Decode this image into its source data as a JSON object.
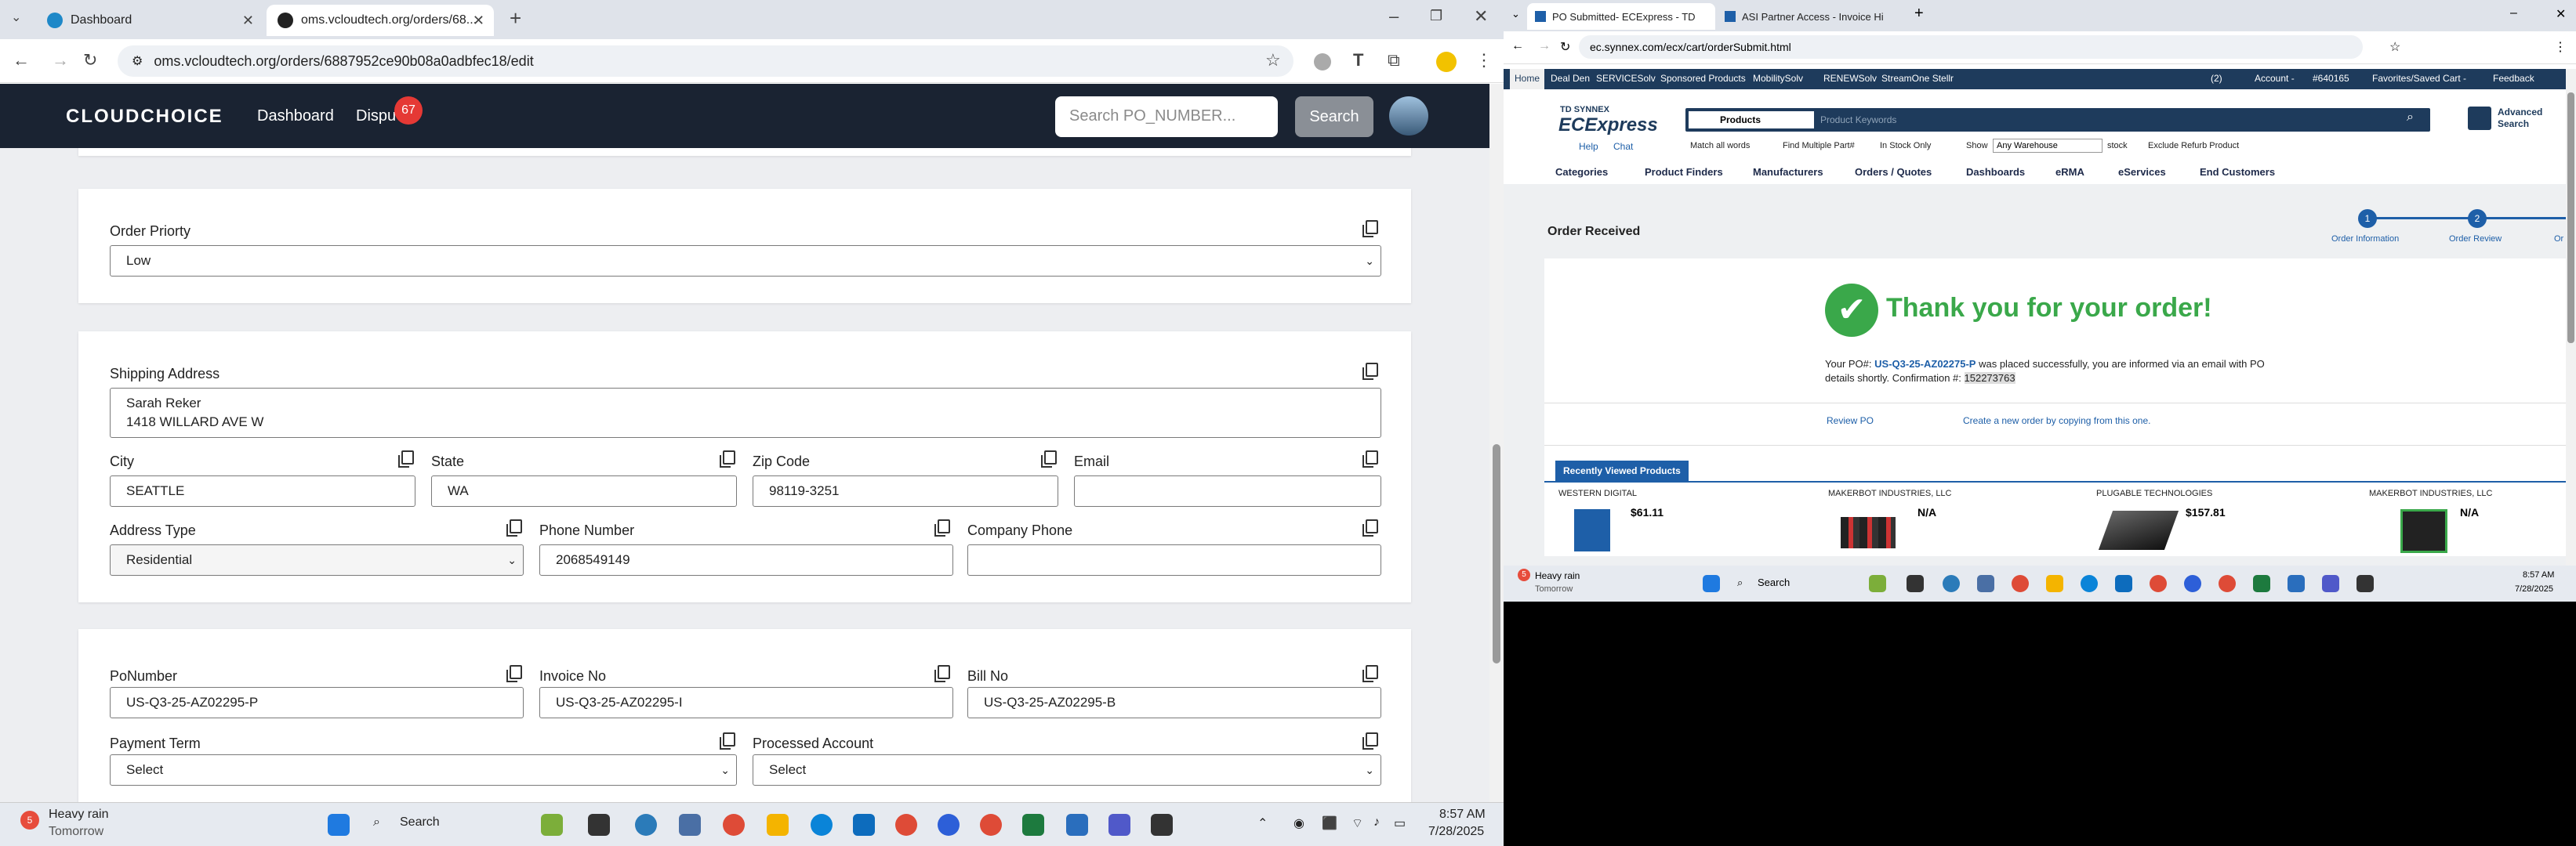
{
  "left": {
    "tabs": [
      {
        "label": "Dashboard",
        "active": false
      },
      {
        "label": "oms.vcloudtech.org/orders/68...",
        "active": true
      }
    ],
    "url": "oms.vcloudtech.org/orders/6887952ce90b08a0adbfec18/edit",
    "app": {
      "logo": "CLOUDCHOICE",
      "nav": [
        "Dashboard",
        "Dispu"
      ],
      "badge": "67",
      "search_placeholder": "Search PO_NUMBER...",
      "search_button": "Search"
    },
    "order_priority": {
      "label": "Order Priorty",
      "value": "Low"
    },
    "shipping": {
      "label": "Shipping Address",
      "line1": "Sarah Reker",
      "line2": "1418 WILLARD AVE W",
      "city_label": "City",
      "city": "SEATTLE",
      "state_label": "State",
      "state": "WA",
      "zip_label": "Zip Code",
      "zip": "98119-3251",
      "email_label": "Email",
      "email": "",
      "address_type_label": "Address Type",
      "address_type": "Residential",
      "phone_label": "Phone Number",
      "phone": "2068549149",
      "company_phone_label": "Company Phone",
      "company_phone": ""
    },
    "po": {
      "po_label": "PoNumber",
      "po": "US-Q3-25-AZ02295-P",
      "invoice_label": "Invoice No",
      "invoice": "US-Q3-25-AZ02295-I",
      "bill_label": "Bill No",
      "bill": "US-Q3-25-AZ02295-B",
      "payment_term_label": "Payment Term",
      "payment_term": "Select",
      "processed_label": "Processed Account",
      "processed": "Select"
    },
    "taskbar": {
      "weather_badge": "5",
      "weather": "Heavy rain",
      "weather_sub": "Tomorrow",
      "search": "Search",
      "time": "8:57 AM",
      "date": "7/28/2025"
    }
  },
  "right": {
    "tabs": [
      {
        "label": "PO Submitted- ECExpress - TD"
      },
      {
        "label": "ASI Partner Access - Invoice Hi"
      }
    ],
    "url": "ec.synnex.com/ecx/cart/orderSubmit.html",
    "topbar": [
      "Home",
      "Deal Den",
      "SERVICESolv",
      "Sponsored Products",
      "MobilitySolv",
      "RENEWSolv",
      "StreamOne Stellr"
    ],
    "topbar_right": [
      "(2)",
      "Account -",
      "#640165",
      "Favorites/Saved Cart -",
      "Feedback"
    ],
    "brand_small": "TD SYNNEX",
    "brand": "ECExpress",
    "search_category": "Products",
    "search_placeholder": "Product Keywords",
    "advanced": [
      "Advanced",
      "Search"
    ],
    "help": "Help",
    "chat": "Chat",
    "opts": [
      "Match all words",
      "Find Multiple Part#",
      "In Stock Only",
      "Show",
      "Any Warehouse",
      "stock",
      "Exclude Refurb Product"
    ],
    "menu": [
      "Categories",
      "Product Finders",
      "Manufacturers",
      "Orders / Quotes",
      "Dashboards",
      "eRMA",
      "eServices",
      "End Customers"
    ],
    "order_received": "Order Received",
    "steps": [
      {
        "n": "1",
        "label": "Order Information"
      },
      {
        "n": "2",
        "label": "Order Review"
      },
      {
        "n": "",
        "label": "Or"
      }
    ],
    "thanks": "Thank you for your order!",
    "msg_prefix": "Your PO#:",
    "msg_po": "US-Q3-25-AZ02275-P",
    "msg_mid": "was placed successfully, you are informed via an email with PO",
    "msg_line2": "details shortly. Confirmation #:",
    "msg_conf": "152273763",
    "review_po": "Review PO",
    "create_new": "Create a new order by copying from this one.",
    "recent": "Recently Viewed Products",
    "products": [
      {
        "vendor": "WESTERN DIGITAL",
        "price": "$61.11"
      },
      {
        "vendor": "MAKERBOT INDUSTRIES, LLC",
        "price": "N/A"
      },
      {
        "vendor": "PLUGABLE TECHNOLOGIES",
        "price": "$157.81"
      },
      {
        "vendor": "MAKERBOT INDUSTRIES, LLC",
        "price": "N/A"
      }
    ],
    "taskbar": {
      "weather_badge": "5",
      "weather": "Heavy rain",
      "weather_sub": "Tomorrow",
      "search": "Search",
      "time": "8:57 AM",
      "date": "7/28/2025"
    }
  }
}
